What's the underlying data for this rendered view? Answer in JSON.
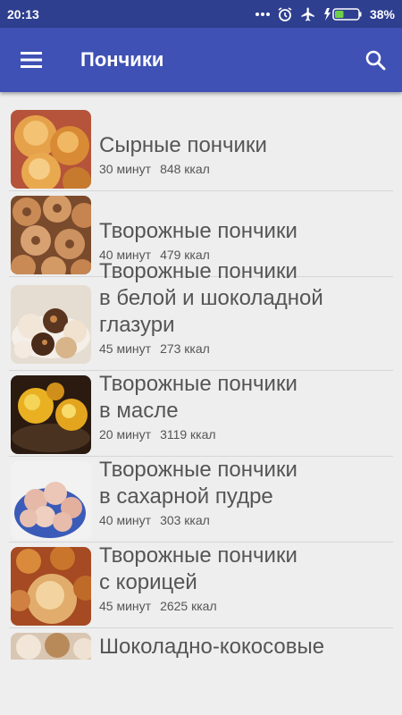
{
  "status_bar": {
    "time": "20:13",
    "battery_percent": "38%",
    "battery_level": 0.38,
    "icons": [
      "more-dots-icon",
      "alarm-icon",
      "airplane-icon",
      "charging-icon",
      "battery-icon"
    ]
  },
  "app_bar": {
    "title": "Пончики",
    "menu_icon": "menu-icon",
    "search_icon": "search-icon",
    "color": "#3f51b5"
  },
  "recipes": [
    {
      "lines": [
        "Сырные пончики"
      ],
      "time": "30 минут",
      "kcal": "848 ккал"
    },
    {
      "lines": [
        "Творожные пончики"
      ],
      "time": "40 минут",
      "kcal": "479 ккал"
    },
    {
      "lines": [
        "Творожные пончики",
        "в белой и шоколадной",
        "глазури"
      ],
      "time": "45 минут",
      "kcal": "273 ккал"
    },
    {
      "lines": [
        "Творожные пончики",
        "в масле"
      ],
      "time": "20 минут",
      "kcal": "3119 ккал"
    },
    {
      "lines": [
        "Творожные пончики",
        "в сахарной пудре"
      ],
      "time": "40 минут",
      "kcal": "303 ккал"
    },
    {
      "lines": [
        "Творожные пончики",
        "с корицей"
      ],
      "time": "45 минут",
      "kcal": "2625 ккал"
    },
    {
      "lines": [
        "Шоколадно-кокосовые"
      ],
      "time": "",
      "kcal": ""
    }
  ]
}
